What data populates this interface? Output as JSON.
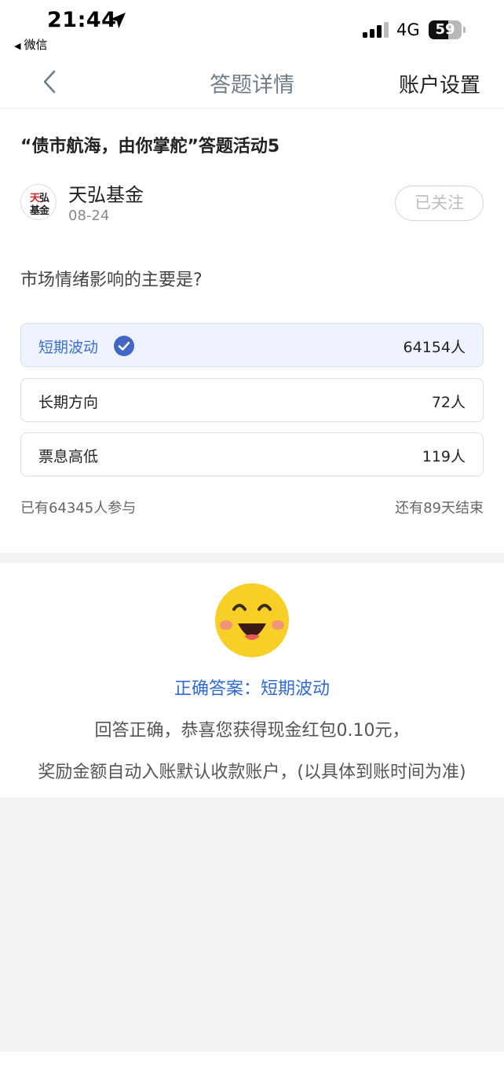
{
  "status_bar": {
    "time": "21:44",
    "back_app": "微信",
    "network": "4G",
    "battery": "59",
    "battery_level": 0.59
  },
  "nav": {
    "title": "答题详情",
    "right": "账户设置"
  },
  "article": {
    "title": "“债市航海，由你掌舵”答题活动5",
    "author": "天弘基金",
    "avatar_line1_red": "天",
    "avatar_line1_rest": "弘",
    "avatar_line2": "基金",
    "date": "08-24",
    "follow_label": "已关注"
  },
  "quiz": {
    "question": "市场情绪影响的主要是?",
    "options": [
      {
        "label": "短期波动",
        "count": "64154人",
        "selected": true
      },
      {
        "label": "长期方向",
        "count": "72人",
        "selected": false
      },
      {
        "label": "票息高低",
        "count": "119人",
        "selected": false
      }
    ],
    "participants": "已有64345人参与",
    "remaining": "还有89天结束"
  },
  "result": {
    "answer": "正确答案：短期波动",
    "reward_line1": "回答正确，恭喜您获得现金红包0.10元，",
    "reward_line2": "奖励金额自动入账默认收款账户，(以具体到账时间为准)"
  },
  "colors": {
    "accent": "#2f6ad9",
    "selected_bg": "#eef3fd",
    "smiley": "#f7cf27",
    "brand_red": "#d9241c"
  }
}
